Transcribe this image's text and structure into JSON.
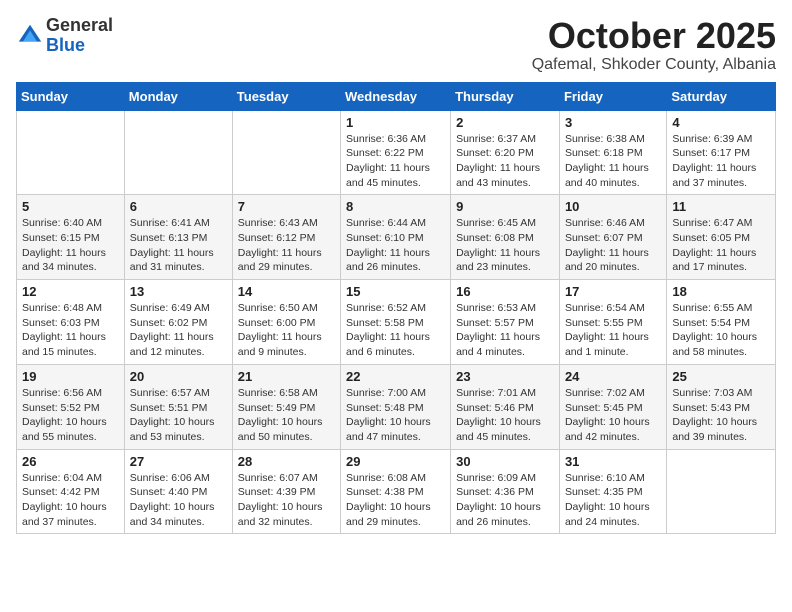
{
  "logo": {
    "general": "General",
    "blue": "Blue"
  },
  "header": {
    "month": "October 2025",
    "location": "Qafemal, Shkoder County, Albania"
  },
  "weekdays": [
    "Sunday",
    "Monday",
    "Tuesday",
    "Wednesday",
    "Thursday",
    "Friday",
    "Saturday"
  ],
  "weeks": [
    [
      null,
      null,
      null,
      {
        "day": "1",
        "sunrise": "6:36 AM",
        "sunset": "6:22 PM",
        "daylight": "11 hours and 45 minutes."
      },
      {
        "day": "2",
        "sunrise": "6:37 AM",
        "sunset": "6:20 PM",
        "daylight": "11 hours and 43 minutes."
      },
      {
        "day": "3",
        "sunrise": "6:38 AM",
        "sunset": "6:18 PM",
        "daylight": "11 hours and 40 minutes."
      },
      {
        "day": "4",
        "sunrise": "6:39 AM",
        "sunset": "6:17 PM",
        "daylight": "11 hours and 37 minutes."
      }
    ],
    [
      {
        "day": "5",
        "sunrise": "6:40 AM",
        "sunset": "6:15 PM",
        "daylight": "11 hours and 34 minutes."
      },
      {
        "day": "6",
        "sunrise": "6:41 AM",
        "sunset": "6:13 PM",
        "daylight": "11 hours and 31 minutes."
      },
      {
        "day": "7",
        "sunrise": "6:43 AM",
        "sunset": "6:12 PM",
        "daylight": "11 hours and 29 minutes."
      },
      {
        "day": "8",
        "sunrise": "6:44 AM",
        "sunset": "6:10 PM",
        "daylight": "11 hours and 26 minutes."
      },
      {
        "day": "9",
        "sunrise": "6:45 AM",
        "sunset": "6:08 PM",
        "daylight": "11 hours and 23 minutes."
      },
      {
        "day": "10",
        "sunrise": "6:46 AM",
        "sunset": "6:07 PM",
        "daylight": "11 hours and 20 minutes."
      },
      {
        "day": "11",
        "sunrise": "6:47 AM",
        "sunset": "6:05 PM",
        "daylight": "11 hours and 17 minutes."
      }
    ],
    [
      {
        "day": "12",
        "sunrise": "6:48 AM",
        "sunset": "6:03 PM",
        "daylight": "11 hours and 15 minutes."
      },
      {
        "day": "13",
        "sunrise": "6:49 AM",
        "sunset": "6:02 PM",
        "daylight": "11 hours and 12 minutes."
      },
      {
        "day": "14",
        "sunrise": "6:50 AM",
        "sunset": "6:00 PM",
        "daylight": "11 hours and 9 minutes."
      },
      {
        "day": "15",
        "sunrise": "6:52 AM",
        "sunset": "5:58 PM",
        "daylight": "11 hours and 6 minutes."
      },
      {
        "day": "16",
        "sunrise": "6:53 AM",
        "sunset": "5:57 PM",
        "daylight": "11 hours and 4 minutes."
      },
      {
        "day": "17",
        "sunrise": "6:54 AM",
        "sunset": "5:55 PM",
        "daylight": "11 hours and 1 minute."
      },
      {
        "day": "18",
        "sunrise": "6:55 AM",
        "sunset": "5:54 PM",
        "daylight": "10 hours and 58 minutes."
      }
    ],
    [
      {
        "day": "19",
        "sunrise": "6:56 AM",
        "sunset": "5:52 PM",
        "daylight": "10 hours and 55 minutes."
      },
      {
        "day": "20",
        "sunrise": "6:57 AM",
        "sunset": "5:51 PM",
        "daylight": "10 hours and 53 minutes."
      },
      {
        "day": "21",
        "sunrise": "6:58 AM",
        "sunset": "5:49 PM",
        "daylight": "10 hours and 50 minutes."
      },
      {
        "day": "22",
        "sunrise": "7:00 AM",
        "sunset": "5:48 PM",
        "daylight": "10 hours and 47 minutes."
      },
      {
        "day": "23",
        "sunrise": "7:01 AM",
        "sunset": "5:46 PM",
        "daylight": "10 hours and 45 minutes."
      },
      {
        "day": "24",
        "sunrise": "7:02 AM",
        "sunset": "5:45 PM",
        "daylight": "10 hours and 42 minutes."
      },
      {
        "day": "25",
        "sunrise": "7:03 AM",
        "sunset": "5:43 PM",
        "daylight": "10 hours and 39 minutes."
      }
    ],
    [
      {
        "day": "26",
        "sunrise": "6:04 AM",
        "sunset": "4:42 PM",
        "daylight": "10 hours and 37 minutes."
      },
      {
        "day": "27",
        "sunrise": "6:06 AM",
        "sunset": "4:40 PM",
        "daylight": "10 hours and 34 minutes."
      },
      {
        "day": "28",
        "sunrise": "6:07 AM",
        "sunset": "4:39 PM",
        "daylight": "10 hours and 32 minutes."
      },
      {
        "day": "29",
        "sunrise": "6:08 AM",
        "sunset": "4:38 PM",
        "daylight": "10 hours and 29 minutes."
      },
      {
        "day": "30",
        "sunrise": "6:09 AM",
        "sunset": "4:36 PM",
        "daylight": "10 hours and 26 minutes."
      },
      {
        "day": "31",
        "sunrise": "6:10 AM",
        "sunset": "4:35 PM",
        "daylight": "10 hours and 24 minutes."
      },
      null
    ]
  ]
}
